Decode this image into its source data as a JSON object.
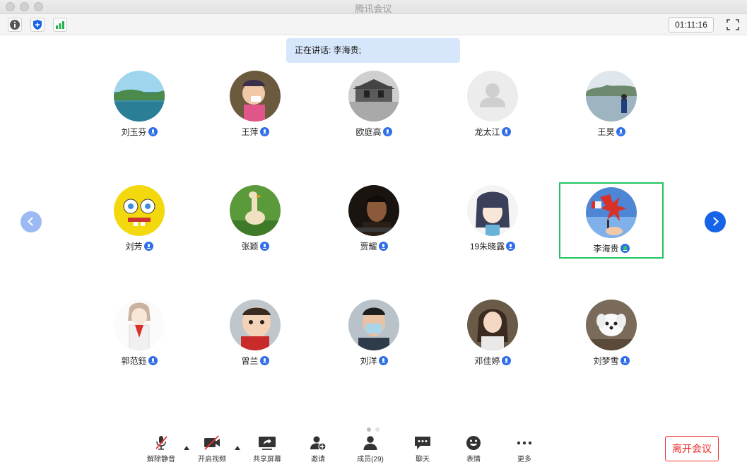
{
  "window": {
    "title": "腾讯会议"
  },
  "toolbar": {
    "info_icon": "info-icon",
    "security_icon": "shield-icon",
    "signal_icon": "signal-bars-icon",
    "timer": "01:11:16",
    "fullscreen_icon": "fullscreen-icon"
  },
  "speaking": {
    "text": "正在讲话: 李海贵;"
  },
  "participants": [
    {
      "name": "刘玉芬",
      "mic": "mic-icon"
    },
    {
      "name": "王萍",
      "mic": "mic-icon"
    },
    {
      "name": "欧庭高",
      "mic": "mic-icon"
    },
    {
      "name": "龙太江",
      "mic": "mic-icon"
    },
    {
      "name": "王昊",
      "mic": "mic-icon"
    },
    {
      "name": "刘芳",
      "mic": "mic-icon"
    },
    {
      "name": "张颖",
      "mic": "mic-icon"
    },
    {
      "name": "贾耀",
      "mic": "mic-icon"
    },
    {
      "name": "19朱晓露",
      "mic": "mic-icon"
    },
    {
      "name": "李海贵",
      "mic": "mic-speaking-icon",
      "active": true
    },
    {
      "name": "郭范鈺",
      "mic": "mic-icon"
    },
    {
      "name": "曾兰",
      "mic": "mic-icon"
    },
    {
      "name": "刘洋",
      "mic": "mic-icon"
    },
    {
      "name": "邓佳婷",
      "mic": "mic-icon"
    },
    {
      "name": "刘梦雪",
      "mic": "mic-icon"
    }
  ],
  "pager": {
    "pages": 2,
    "current": 1
  },
  "bottombar": {
    "unmute": "解除静音",
    "start_video": "开启视频",
    "share_screen": "共享屏幕",
    "invite": "邀请",
    "members": "成员(29)",
    "chat": "聊天",
    "reactions": "表情",
    "more": "更多",
    "leave": "离开会议"
  },
  "colors": {
    "accent": "#1763e8",
    "active_border": "#22c55e",
    "leave": "#e22222"
  }
}
